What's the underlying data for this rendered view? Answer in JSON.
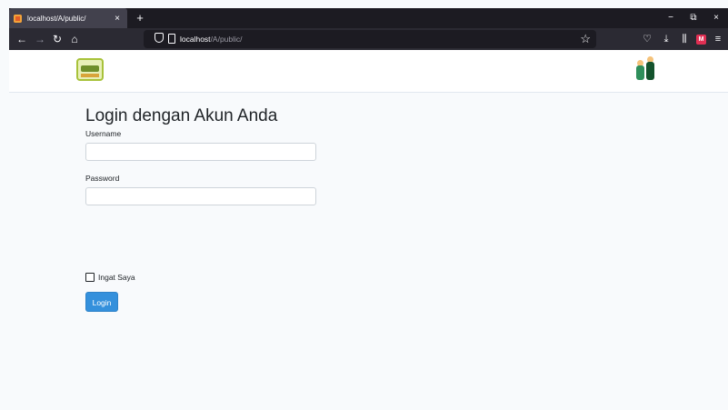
{
  "browser": {
    "tab_title": "localhost/A/public/",
    "tab_close": "×",
    "new_tab": "+",
    "url_host": "localhost",
    "url_path": "/A/public/",
    "controls": {
      "minimize": "−",
      "restore": "⧉",
      "close": "×"
    },
    "nav": {
      "back": "←",
      "forward": "→",
      "reload": "↻",
      "home": "⌂"
    },
    "bookmark_star": "☆",
    "toolbar": {
      "pocket": "♡",
      "downloads": "⤓",
      "library": "⫼",
      "extension": "M",
      "menu": "≡"
    }
  },
  "login": {
    "heading": "Login dengan Akun Anda",
    "username_label": "Username",
    "username_value": "",
    "password_label": "Password",
    "password_value": "",
    "remember_label": "Ingat Saya",
    "remember_checked": false,
    "submit_label": "Login"
  },
  "colors": {
    "primary": "#3490dc",
    "background": "#f8fafc"
  }
}
